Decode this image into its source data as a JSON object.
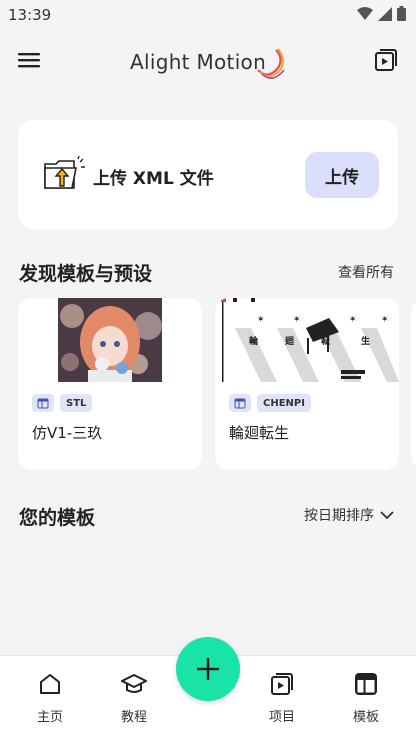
{
  "status_bar": {
    "time": "13:39"
  },
  "app_bar": {
    "logo_text": "Alight Motion"
  },
  "upload_card": {
    "label": "上传 XML 文件",
    "button": "上传"
  },
  "discover": {
    "title": "发现模板与预设",
    "see_all": "查看所有",
    "templates": [
      {
        "tag": "STL",
        "name": "仿V1-三玖"
      },
      {
        "tag": "CHENPI",
        "name": "輪廻転生",
        "thumb_text": [
          "輪",
          "廻",
          "転",
          "生"
        ]
      }
    ]
  },
  "my_templates": {
    "title": "您的模板",
    "sort_label": "按日期排序"
  },
  "bottom_nav": {
    "items": [
      {
        "label": "主页",
        "icon": "home-icon"
      },
      {
        "label": "教程",
        "icon": "graduation-cap-icon"
      },
      {
        "label": "项目",
        "icon": "project-play-icon"
      },
      {
        "label": "模板",
        "icon": "template-icon"
      }
    ],
    "fab_icon": "plus-icon"
  },
  "colors": {
    "accent": "#19e3a6",
    "upload_button_bg": "#dcdffb",
    "tag_bg": "#dfe4f7"
  }
}
